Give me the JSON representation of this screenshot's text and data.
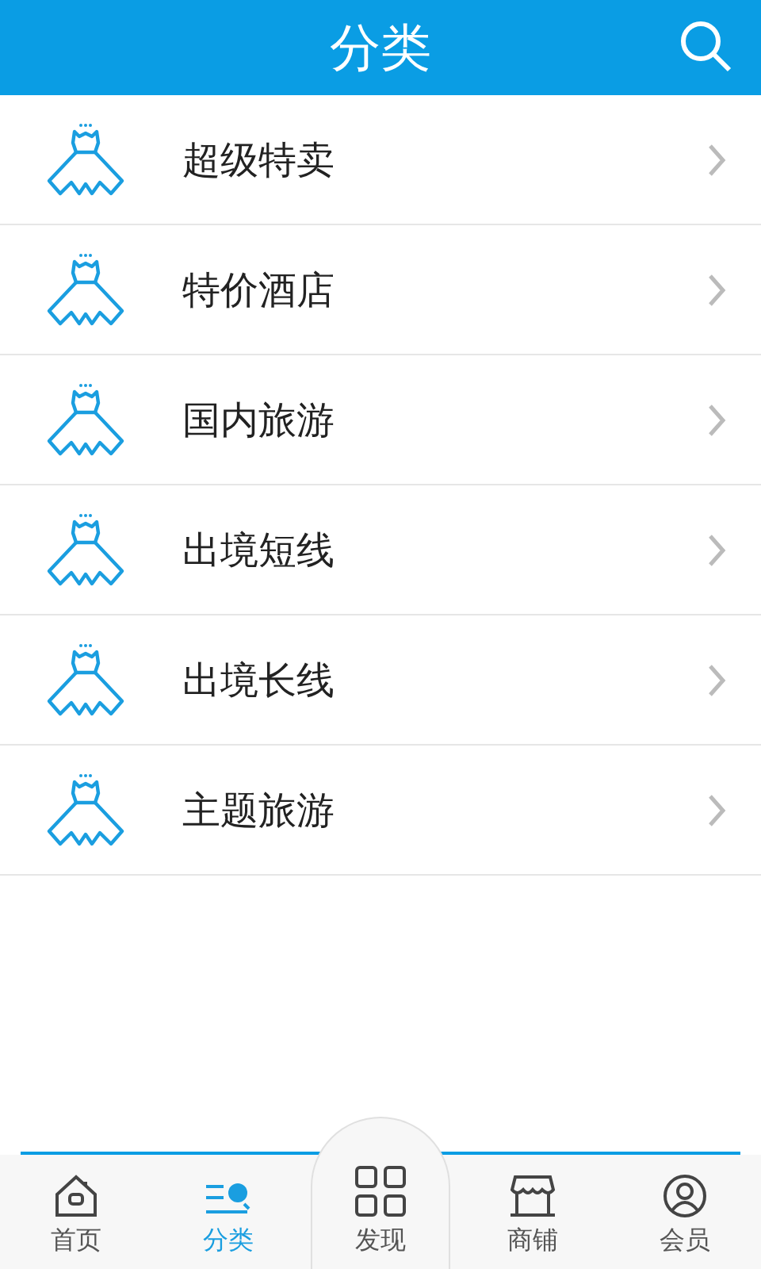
{
  "header": {
    "title": "分类"
  },
  "categories": [
    {
      "label": "超级特卖"
    },
    {
      "label": "特价酒店"
    },
    {
      "label": "国内旅游"
    },
    {
      "label": "出境短线"
    },
    {
      "label": "出境长线"
    },
    {
      "label": "主题旅游"
    }
  ],
  "tabs": [
    {
      "label": "首页",
      "selected": false
    },
    {
      "label": "分类",
      "selected": true
    },
    {
      "label": "发现",
      "selected": false
    },
    {
      "label": "商铺",
      "selected": false
    },
    {
      "label": "会员",
      "selected": false
    }
  ]
}
